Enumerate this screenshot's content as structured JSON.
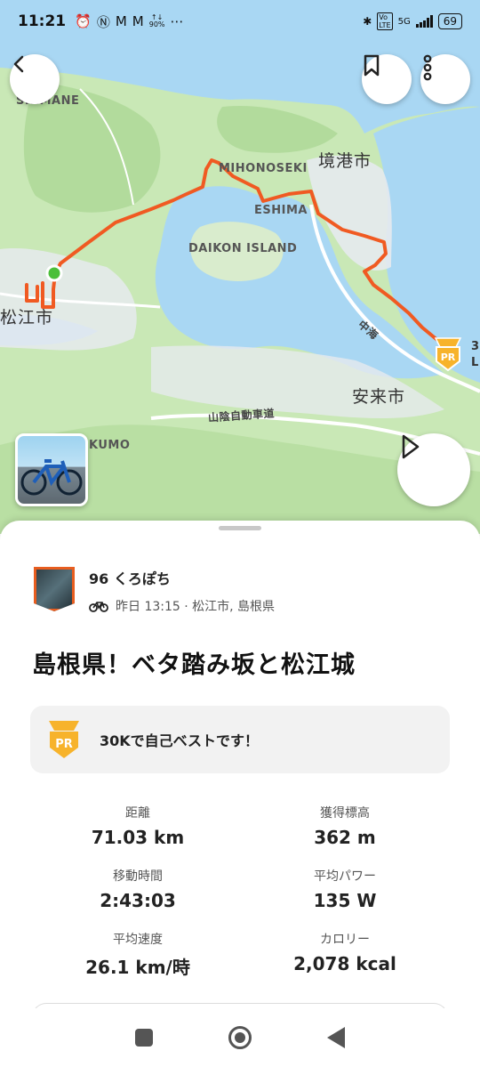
{
  "statusbar": {
    "time": "11:21",
    "battery": "69",
    "network": "5G",
    "data_rate": "90%"
  },
  "map": {
    "labels": {
      "shimane": "SHIMANE",
      "mihonoseki": "MIHONOSEKI",
      "sakaiminato": "境港市",
      "eshima": "ESHIMA",
      "daikon_island": "DAIKON ISLAND",
      "nakaumi": "中海",
      "matsue": "松江市",
      "yasugi": "安来市",
      "expressway": "山陰自動車道",
      "izumo": "KUMO",
      "pr_side": "3",
      "pr_side2": "L"
    },
    "colors": {
      "route": "#f05a22",
      "water": "#a9d7f3",
      "land": "#c9e8b6",
      "urban": "#e6eaee"
    }
  },
  "sheet": {
    "athlete_name": "96 くろぽち",
    "meta": "昨日 13:15 · 松江市, 島根県",
    "title": "島根県！ベタ踏み坂と松江城",
    "pr_text": "30Kで自己ベストです！",
    "pr_badge": "PR",
    "stats": [
      {
        "label": "距離",
        "value": "71.03 km"
      },
      {
        "label": "獲得標高",
        "value": "362 m"
      },
      {
        "label": "移動時間",
        "value": "2:43:03"
      },
      {
        "label": "平均パワー",
        "value": "135 W"
      },
      {
        "label": "平均速度",
        "value": "26.1 km/時"
      },
      {
        "label": "カロリー",
        "value": "2,078 kcal"
      }
    ]
  },
  "icons": {
    "back": "chevron-left-icon",
    "bookmark": "bookmark-icon",
    "more": "more-vertical-icon",
    "play": "play-icon",
    "bike": "bike-icon",
    "pr": "pr-medal-icon"
  }
}
